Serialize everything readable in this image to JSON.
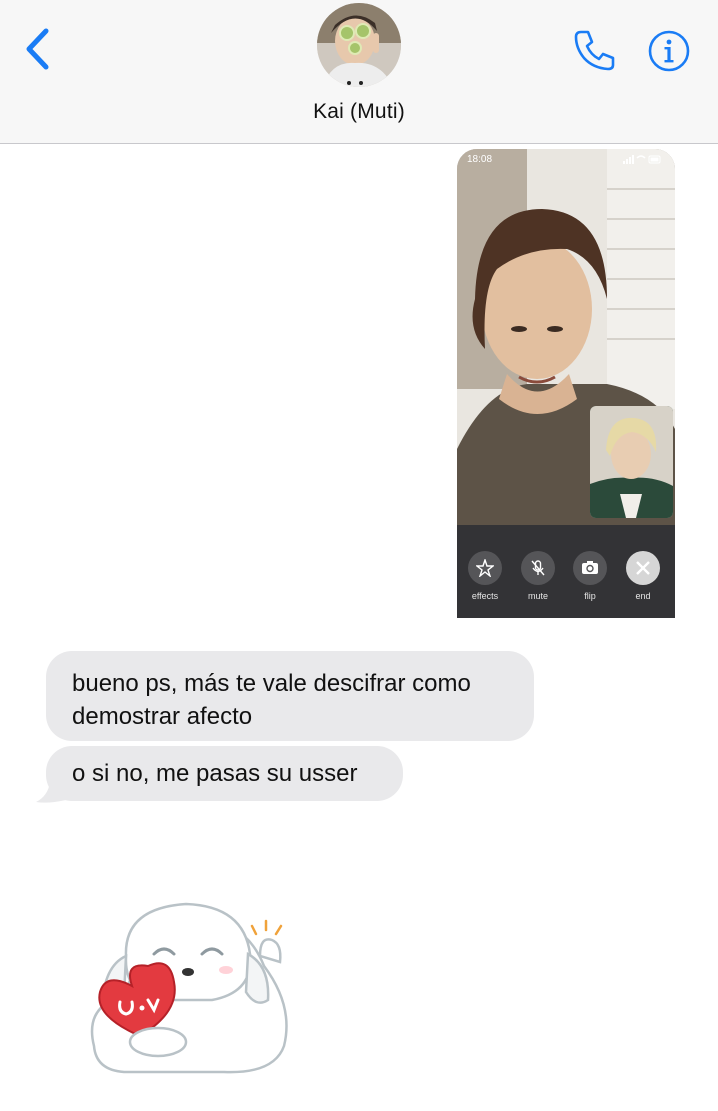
{
  "header": {
    "back_icon": "chevron-left-icon",
    "contact_name": "Kai (Muti)",
    "call_icon": "phone-icon",
    "info_icon": "info-icon",
    "accent_color": "#1a7cf5"
  },
  "thread": {
    "outgoing_media": {
      "type": "facetime-screenshot",
      "status_time": "18:08",
      "controls": [
        {
          "icon": "star-effects-icon",
          "label": "effects"
        },
        {
          "icon": "mic-mute-icon",
          "label": "mute"
        },
        {
          "icon": "camera-flip-icon",
          "label": "flip"
        },
        {
          "icon": "close-icon",
          "label": "end"
        }
      ]
    },
    "incoming_messages": [
      {
        "text_line1": "bueno ps, más te vale descifrar como",
        "text_line2": "demostrar afecto"
      },
      {
        "text": "o si no, me pasas su usser"
      }
    ],
    "sticker": {
      "icon": "puppy-heart-sticker-icon"
    }
  }
}
